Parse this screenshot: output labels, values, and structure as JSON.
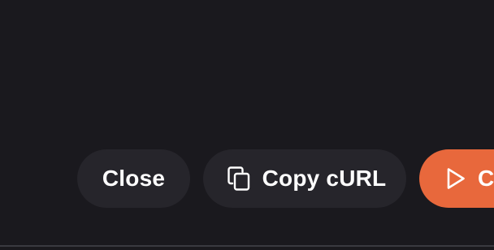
{
  "actions": {
    "close_label": "Close",
    "copy_label": "Copy cURL",
    "run_label_visible": "C"
  },
  "icons": {
    "copy": "copy-icon",
    "run": "play-icon"
  },
  "colors": {
    "background": "#1a191e",
    "secondary_button": "#26252b",
    "primary_button": "#e8683c",
    "text": "#ffffff"
  }
}
